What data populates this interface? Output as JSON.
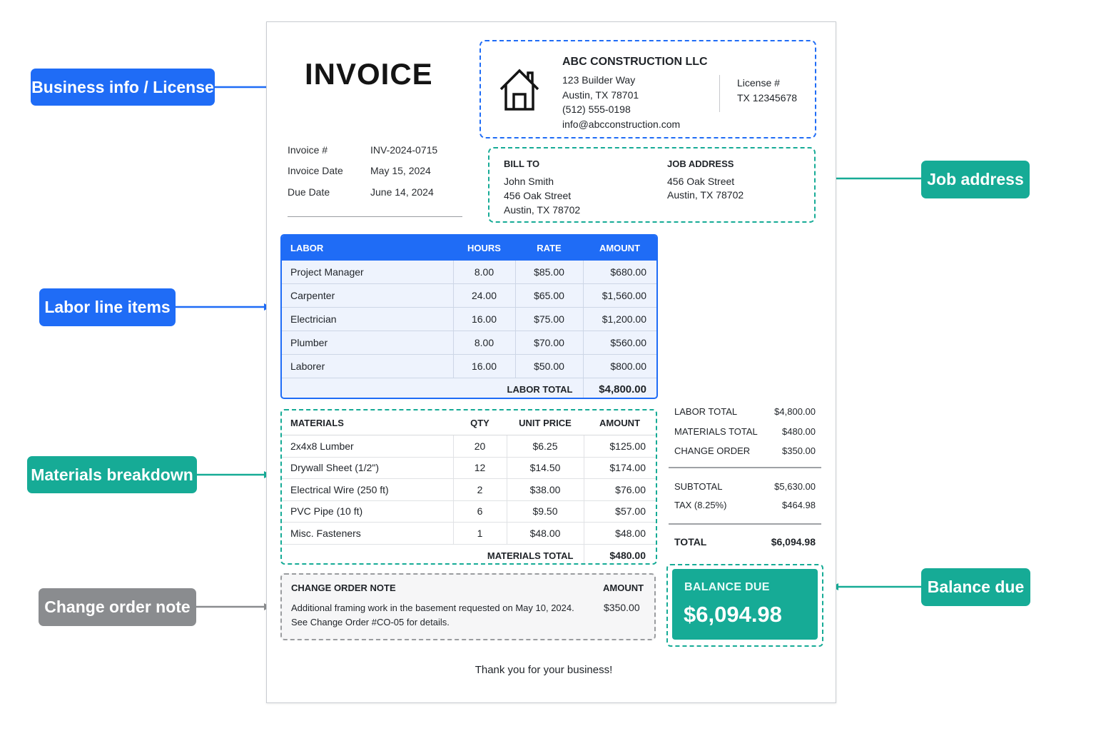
{
  "callouts": {
    "business": "Business info / License",
    "labor": "Labor line items",
    "materials": "Materials breakdown",
    "change_order": "Change order note",
    "job_address": "Job address",
    "balance_due": "Balance due"
  },
  "colors": {
    "blue": "#1f6cf6",
    "teal": "#16ab96",
    "gray": "#8a8c8f"
  },
  "invoice": {
    "title": "INVOICE",
    "meta": [
      {
        "label": "Invoice #",
        "value": "INV-2024-0715"
      },
      {
        "label": "Invoice Date",
        "value": "May 15, 2024"
      },
      {
        "label": "Due Date",
        "value": "June 14, 2024"
      }
    ]
  },
  "business": {
    "icon": "house-icon",
    "name": "ABC CONSTRUCTION LLC",
    "address1": "123 Builder Way",
    "address2": "Austin, TX 78701",
    "phone": "(512) 555-0198",
    "email": "info@abcconstruction.com",
    "license_label": "License #",
    "license_value": "TX 12345678"
  },
  "bill_to": {
    "heading": "BILL TO",
    "name": "John Smith",
    "street": "456 Oak Street",
    "city": "Austin, TX 78702"
  },
  "job_address": {
    "heading": "JOB ADDRESS",
    "street": "456 Oak Street",
    "city": "Austin, TX 78702"
  },
  "labor": {
    "headers": [
      "LABOR",
      "HOURS",
      "RATE",
      "AMOUNT"
    ],
    "rows": [
      [
        "Project Manager",
        "8.00",
        "$85.00",
        "$680.00"
      ],
      [
        "Carpenter",
        "24.00",
        "$65.00",
        "$1,560.00"
      ],
      [
        "Electrician",
        "16.00",
        "$75.00",
        "$1,200.00"
      ],
      [
        "Plumber",
        "8.00",
        "$70.00",
        "$560.00"
      ],
      [
        "Laborer",
        "16.00",
        "$50.00",
        "$800.00"
      ]
    ],
    "total_label": "LABOR TOTAL",
    "total_value": "$4,800.00"
  },
  "materials": {
    "headers": [
      "MATERIALS",
      "QTY",
      "UNIT PRICE",
      "AMOUNT"
    ],
    "rows": [
      [
        "2x4x8 Lumber",
        "20",
        "$6.25",
        "$125.00"
      ],
      [
        "Drywall Sheet (1/2\")",
        "12",
        "$14.50",
        "$174.00"
      ],
      [
        "Electrical Wire (250 ft)",
        "2",
        "$38.00",
        "$76.00"
      ],
      [
        "PVC Pipe (10 ft)",
        "6",
        "$9.50",
        "$57.00"
      ],
      [
        "Misc. Fasteners",
        "1",
        "$48.00",
        "$48.00"
      ]
    ],
    "total_label": "MATERIALS TOTAL",
    "total_value": "$480.00"
  },
  "change_order": {
    "title": "CHANGE ORDER NOTE",
    "amount_label": "AMOUNT",
    "line1": "Additional framing work in the basement requested on May 10, 2024.",
    "line2": "See Change Order #CO-05 for details.",
    "amount": "$350.00"
  },
  "summary": {
    "labor_total_label": "LABOR TOTAL",
    "labor_total_value": "$4,800.00",
    "materials_total_label": "MATERIALS TOTAL",
    "materials_total_value": "$480.00",
    "change_order_label": "CHANGE ORDER",
    "change_order_value": "$350.00",
    "subtotal_label": "SUBTOTAL",
    "subtotal_value": "$5,630.00",
    "tax_label": "TAX (8.25%)",
    "tax_value": "$464.98",
    "total_label": "TOTAL",
    "total_value": "$6,094.98"
  },
  "balance": {
    "label": "BALANCE DUE",
    "value": "$6,094.98"
  },
  "footer": {
    "thanks": "Thank you for your business!"
  }
}
